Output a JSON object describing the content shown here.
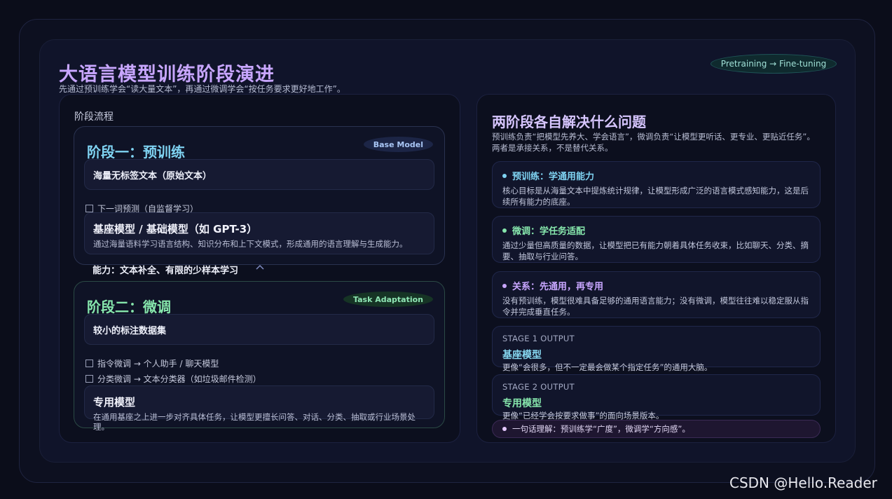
{
  "header": {
    "title": "大语言模型训练阶段演进",
    "subtitle": "先通过预训练学会“读大量文本”，再通过微调学会“按任务要求更好地工作”。",
    "pill": "Pretraining → Fine-tuning"
  },
  "left": {
    "label": "阶段流程",
    "stage1": {
      "title": "阶段一：预训练",
      "badge": "Base Model",
      "input": "海量无标签文本（原始文本）",
      "task": "下一词预测（自监督学习）",
      "model_title": "基座模型 / 基础模型（如 GPT-3）",
      "model_desc": "通过海量语料学习语言结构、知识分布和上下文模式，形成通用的语言理解与生成能力。",
      "ability": "能力：文本补全、有限的少样本学习"
    },
    "stage2": {
      "title": "阶段二：微调",
      "badge": "Task Adaptation",
      "input": "较小的标注数据集",
      "task1": "指令微调 → 个人助手 / 聊天模型",
      "task2": "分类微调 → 文本分类器（如垃圾邮件检测）",
      "model_title": "专用模型",
      "model_desc": "在通用基座之上进一步对齐具体任务，让模型更擅长问答、对话、分类、抽取或行业场景处理。"
    }
  },
  "right": {
    "title": "两阶段各自解决什么问题",
    "subtitle": "预训练负责“把模型先养大、学会语言”，微调负责“让模型更听话、更专业、更贴近任务”。两者是承接关系，不是替代关系。",
    "items": [
      {
        "head": "预训练：学通用能力",
        "body": "核心目标是从海量文本中提炼统计规律，让模型形成广泛的语言模式感知能力，这是后续所有能力的底座。",
        "color": "#7fd3f2"
      },
      {
        "head": "微调：学任务适配",
        "body": "通过少量但高质量的数据，让模型把已有能力朝着具体任务收束，比如聊天、分类、摘要、抽取与行业问答。",
        "color": "#86e6ac"
      },
      {
        "head": "关系：先通用，再专用",
        "body": "没有预训练，模型很难具备足够的通用语言能力；没有微调，模型往往难以稳定服从指令并完成垂直任务。",
        "color": "#c8a6ff"
      }
    ],
    "outputs": [
      {
        "label": "STAGE 1 OUTPUT",
        "title": "基座模型",
        "desc": "更像“会很多，但不一定最会做某个指定任务”的通用大脑。"
      },
      {
        "label": "STAGE 2 OUTPUT",
        "title": "专用模型",
        "desc": "更像“已经学会按要求做事”的面向场景版本。"
      }
    ],
    "summary": "一句话理解：预训练学“广度”，微调学“方向感”。"
  },
  "watermark": "CSDN @Hello.Reader"
}
